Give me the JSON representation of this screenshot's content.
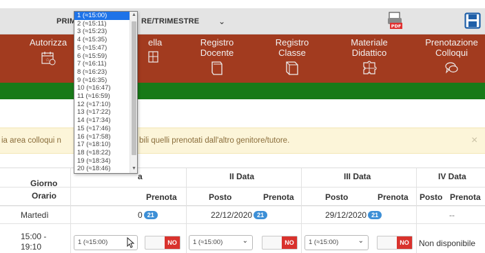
{
  "toolbar": {
    "period_left": "PRIM",
    "period_right": "RE/TRIMESTRE",
    "chevron": "⌄",
    "pdf_icon": "pdf-export-icon",
    "save_icon": "save-floppy-icon"
  },
  "nav": {
    "items": [
      {
        "line1": "Autorizza",
        "line2": "",
        "icon": "calendar-icon"
      },
      {
        "line1": "ella",
        "line2": "",
        "icon": "grid-icon"
      },
      {
        "line1": "Registro",
        "line2": "Docente",
        "icon": "book-icon"
      },
      {
        "line1": "Registro",
        "line2": "Classe",
        "icon": "notebook-icon"
      },
      {
        "line1": "Materiale",
        "line2": "Didattico",
        "icon": "puzzle-icon"
      },
      {
        "line1": "Prenotazione",
        "line2": "Colloqui",
        "icon": "chat-icon"
      }
    ],
    "colors": {
      "nav_bg": "#a23b1f",
      "green_bar": "#187a18"
    }
  },
  "notice": {
    "part1": "ia area colloqui n",
    "part2": "bili quelli prenotati dall'altro genitore/tutore.",
    "close": "×"
  },
  "table": {
    "headers": {
      "giorno": "Giorno",
      "orario": "Orario",
      "first_suffix": "a",
      "second": "II Data",
      "third": "III Data",
      "fourth": "IV Data",
      "posto": "Posto",
      "prenota": "Prenota",
      "prenota_cut": "Prenota"
    },
    "row": {
      "day": "Martedì",
      "time_line1": "15:00 -",
      "time_line2": "19:10",
      "date1_tail": "0",
      "date1_badge": "21",
      "date2": "22/12/2020",
      "date2_badge": "21",
      "date3": "29/12/2020",
      "date3_badge": "21",
      "date4": "--",
      "select1": "1 (≈15:00)",
      "select2": "1 (≈15:00)",
      "select3": "1 (≈15:00)",
      "toggle_no": "NO",
      "unavailable": "Non disponibile"
    }
  },
  "dropdown": {
    "options": [
      "1 (≈15:00)",
      "2 (≈15:11)",
      "3 (≈15:23)",
      "4 (≈15:35)",
      "5 (≈15:47)",
      "6 (≈15:59)",
      "7 (≈16:11)",
      "8 (≈16:23)",
      "9 (≈16:35)",
      "10 (≈16:47)",
      "11 (≈16:59)",
      "12 (≈17:10)",
      "13 (≈17:22)",
      "14 (≈17:34)",
      "15 (≈17:46)",
      "16 (≈17:58)",
      "17 (≈18:10)",
      "18 (≈18:22)",
      "19 (≈18:34)",
      "20 (≈18:46)"
    ],
    "selected_index": 0,
    "scroll_up": "▲",
    "scroll_down": "▼"
  }
}
